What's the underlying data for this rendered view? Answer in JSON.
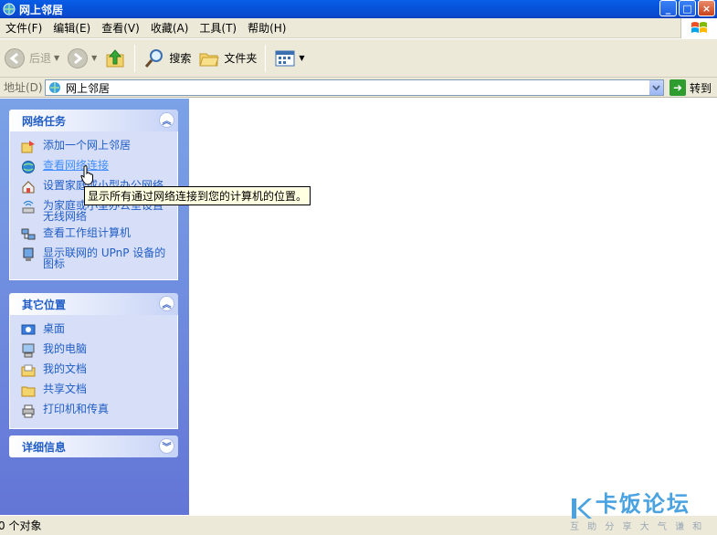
{
  "window": {
    "title": "网上邻居",
    "controls": {
      "minimize": "_",
      "maximize": "□",
      "close": "×"
    }
  },
  "menubar": {
    "items": [
      "文件(F)",
      "编辑(E)",
      "查看(V)",
      "收藏(A)",
      "工具(T)",
      "帮助(H)"
    ]
  },
  "toolbar": {
    "back_label": "后退",
    "search_label": "搜索",
    "folders_label": "文件夹"
  },
  "addressbar": {
    "label": "地址(D)",
    "value": "网上邻居",
    "go_label": "转到"
  },
  "taskpane": {
    "network_tasks": {
      "title": "网络任务",
      "items": [
        {
          "label": "添加一个网上邻居",
          "icon": "add-network-place-icon"
        },
        {
          "label": "查看网络连接",
          "icon": "network-connections-icon"
        },
        {
          "label": "设置家庭或小型办公网络",
          "icon": "home-network-setup-icon"
        },
        {
          "label": "为家庭或小型办公室设置无线网络",
          "icon": "wireless-network-icon"
        },
        {
          "label": "查看工作组计算机",
          "icon": "workgroup-computers-icon"
        },
        {
          "label": "显示联网的 UPnP 设备的图标",
          "icon": "upnp-device-icon"
        }
      ]
    },
    "other_places": {
      "title": "其它位置",
      "items": [
        {
          "label": "桌面",
          "icon": "desktop-icon"
        },
        {
          "label": "我的电脑",
          "icon": "my-computer-icon"
        },
        {
          "label": "我的文档",
          "icon": "my-documents-icon"
        },
        {
          "label": "共享文档",
          "icon": "shared-documents-icon"
        },
        {
          "label": "打印机和传真",
          "icon": "printers-faxes-icon"
        }
      ]
    },
    "details": {
      "title": "详细信息"
    }
  },
  "tooltip": {
    "text": "显示所有通过网络连接到您的计算机的位置。"
  },
  "statusbar": {
    "text": "0 个对象"
  },
  "watermark": {
    "name": "卡饭论坛",
    "slogan": "互 助 分 享   大 气 谦 和"
  },
  "colors": {
    "titlebar": "#0a5ee8",
    "taskpane": "#7ba2e7",
    "task_link": "#215dc6",
    "chrome": "#ece9d8",
    "tooltip_bg": "#ffffe1"
  }
}
